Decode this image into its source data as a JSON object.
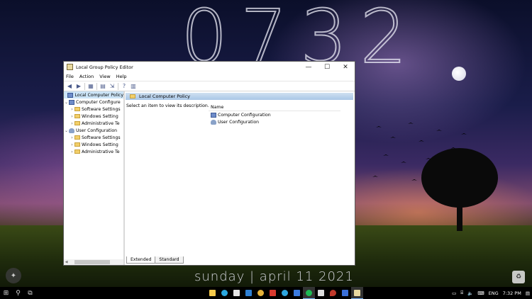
{
  "desktop": {
    "clock": "0732",
    "date": "sunday | april 11 2021"
  },
  "window": {
    "title": "Local Group Policy Editor",
    "controls": {
      "minimize": "—",
      "maximize": "☐",
      "close": "✕"
    },
    "menu": [
      "File",
      "Action",
      "View",
      "Help"
    ],
    "tree": {
      "root": "Local Computer Policy",
      "computer": "Computer Configure",
      "computer_children": [
        "Software Settings",
        "Windows Setting",
        "Administrative Te"
      ],
      "user": "User Configuration",
      "user_children": [
        "Software Settings",
        "Windows Setting",
        "Administrative Te"
      ]
    },
    "right_header": "Local Computer Policy",
    "description": "Select an item to view its description.",
    "list_column": "Name",
    "list_items": [
      "Computer Configuration",
      "User Configuration"
    ],
    "tabs": [
      "Extended",
      "Standard"
    ]
  },
  "taskbar": {
    "language": "ENG",
    "time": "7:32 PM"
  }
}
